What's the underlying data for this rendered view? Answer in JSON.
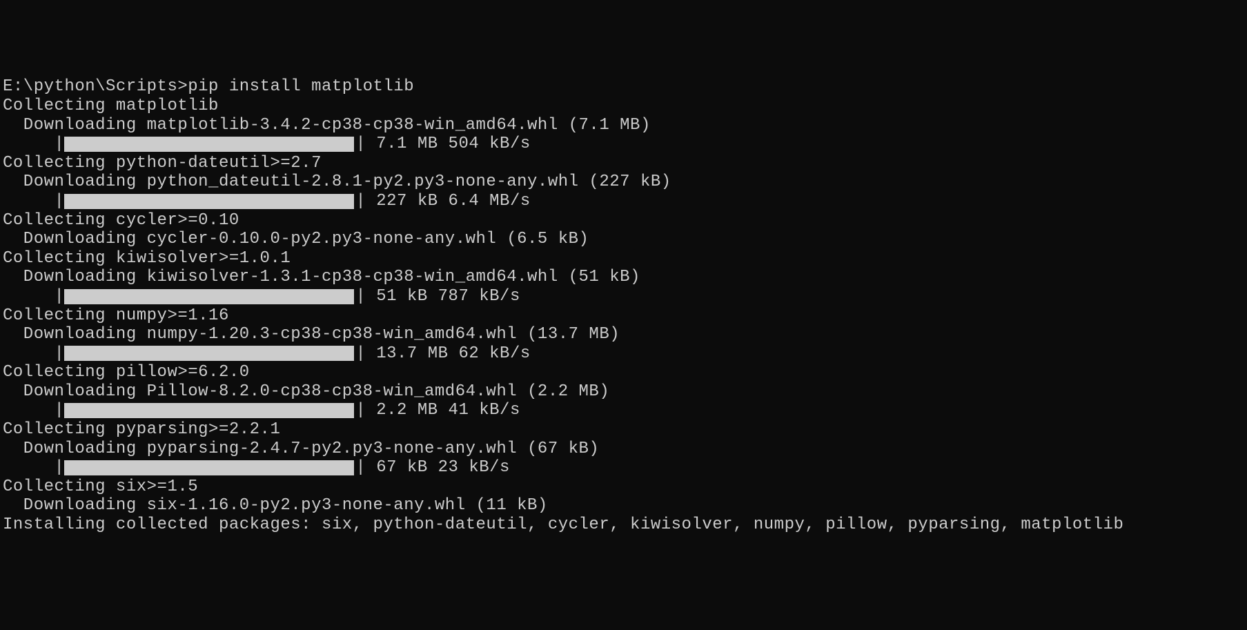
{
  "prompt": "E:\\python\\Scripts>",
  "command": "pip install matplotlib",
  "blocks": [
    {
      "collecting": "Collecting matplotlib",
      "downloading": "  Downloading matplotlib-3.4.2-cp38-cp38-win_amd64.whl (7.1 MB)",
      "progress": {
        "prefix": "     |",
        "suffix": "| 7.1 MB 504 kB/s"
      }
    },
    {
      "collecting": "Collecting python-dateutil>=2.7",
      "downloading": "  Downloading python_dateutil-2.8.1-py2.py3-none-any.whl (227 kB)",
      "progress": {
        "prefix": "     |",
        "suffix": "| 227 kB 6.4 MB/s"
      }
    },
    {
      "collecting": "Collecting cycler>=0.10",
      "downloading": "  Downloading cycler-0.10.0-py2.py3-none-any.whl (6.5 kB)"
    },
    {
      "collecting": "Collecting kiwisolver>=1.0.1",
      "downloading": "  Downloading kiwisolver-1.3.1-cp38-cp38-win_amd64.whl (51 kB)",
      "progress": {
        "prefix": "     |",
        "suffix": "| 51 kB 787 kB/s"
      }
    },
    {
      "collecting": "Collecting numpy>=1.16",
      "downloading": "  Downloading numpy-1.20.3-cp38-cp38-win_amd64.whl (13.7 MB)",
      "progress": {
        "prefix": "     |",
        "suffix": "| 13.7 MB 62 kB/s"
      }
    },
    {
      "collecting": "Collecting pillow>=6.2.0",
      "downloading": "  Downloading Pillow-8.2.0-cp38-cp38-win_amd64.whl (2.2 MB)",
      "progress": {
        "prefix": "     |",
        "suffix": "| 2.2 MB 41 kB/s"
      }
    },
    {
      "collecting": "Collecting pyparsing>=2.2.1",
      "downloading": "  Downloading pyparsing-2.4.7-py2.py3-none-any.whl (67 kB)",
      "progress": {
        "prefix": "     |",
        "suffix": "| 67 kB 23 kB/s"
      }
    },
    {
      "collecting": "Collecting six>=1.5",
      "downloading": "  Downloading six-1.16.0-py2.py3-none-any.whl (11 kB)"
    }
  ],
  "installing": "Installing collected packages: six, python-dateutil, cycler, kiwisolver, numpy, pillow, pyparsing, matplotlib"
}
